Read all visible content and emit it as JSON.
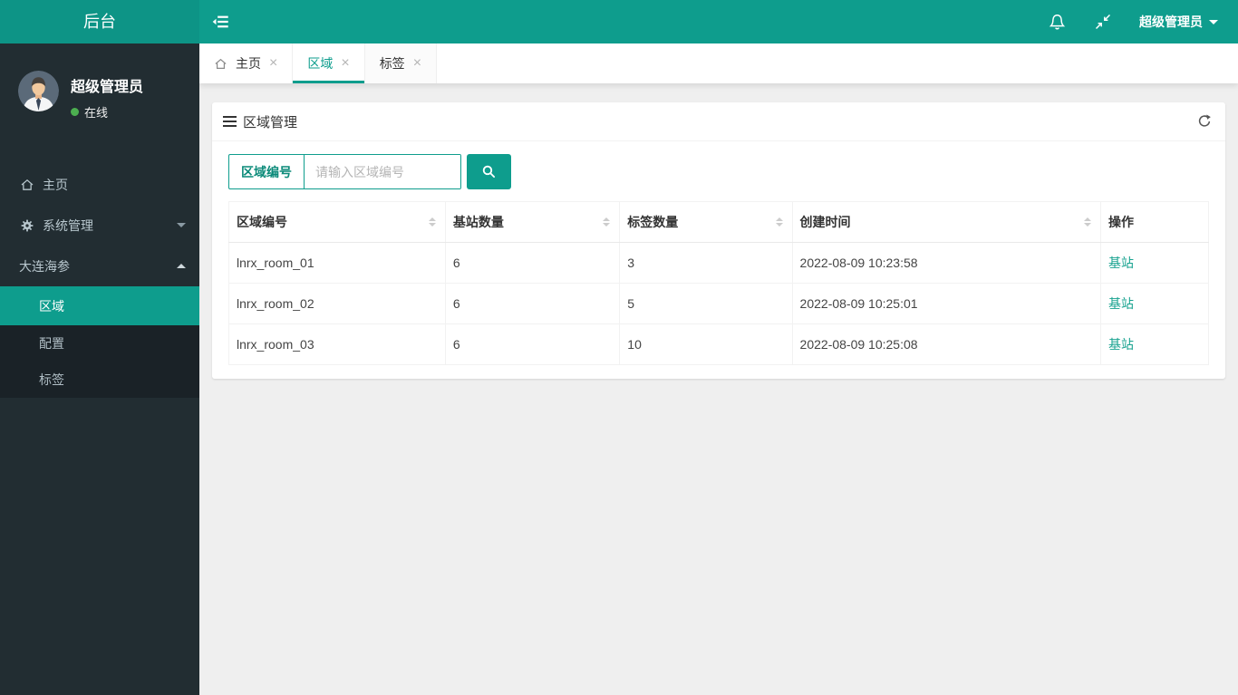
{
  "navbar": {
    "brand": "后台",
    "user_menu": "超级管理员",
    "icons": [
      "sidebar-toggle",
      "bell",
      "compress-fullscreen",
      "caret-down"
    ]
  },
  "sidebar": {
    "user": {
      "name": "超级管理员",
      "status": "在线",
      "status_color": "#4caf50"
    },
    "items": [
      {
        "label": "主页",
        "icon": "home-icon"
      },
      {
        "label": "系统管理",
        "icon": "gear-icon",
        "caret": "down"
      },
      {
        "label": "大连海参",
        "icon": "none",
        "caret": "up",
        "expanded": true
      }
    ],
    "submenu": [
      {
        "label": "区域",
        "active": true
      },
      {
        "label": "配置",
        "active": false
      },
      {
        "label": "标签",
        "active": false
      }
    ]
  },
  "tabs": [
    {
      "label": "主页",
      "icon": "home-icon",
      "closable": true,
      "active": false
    },
    {
      "label": "区域",
      "closable": true,
      "active": true
    },
    {
      "label": "标签",
      "closable": true,
      "active": false
    }
  ],
  "tab_close_glyph": "×",
  "panel": {
    "title": "区域管理",
    "search": {
      "label": "区域编号",
      "placeholder": "请输入区域编号",
      "icon": "magnifier"
    },
    "table": {
      "headers": [
        "区域编号",
        "基站数量",
        "标签数量",
        "创建时间",
        "操作"
      ],
      "sortable_columns": [
        0,
        1,
        2,
        3
      ],
      "rows": [
        [
          "lnrx_room_01",
          "6",
          "3",
          "2022-08-09 10:23:58",
          "基站"
        ],
        [
          "lnrx_room_02",
          "6",
          "5",
          "2022-08-09 10:25:01",
          "基站"
        ],
        [
          "lnrx_room_03",
          "6",
          "10",
          "2022-08-09 10:25:08",
          "基站"
        ]
      ]
    }
  },
  "theme": {
    "teal": "#0e9d8d",
    "sidebar_bg": "#222d32",
    "submenu_bg": "#1a2227",
    "content_bg": "#efefef",
    "link_color": "#17a28f",
    "online_green": "#4caf50"
  }
}
